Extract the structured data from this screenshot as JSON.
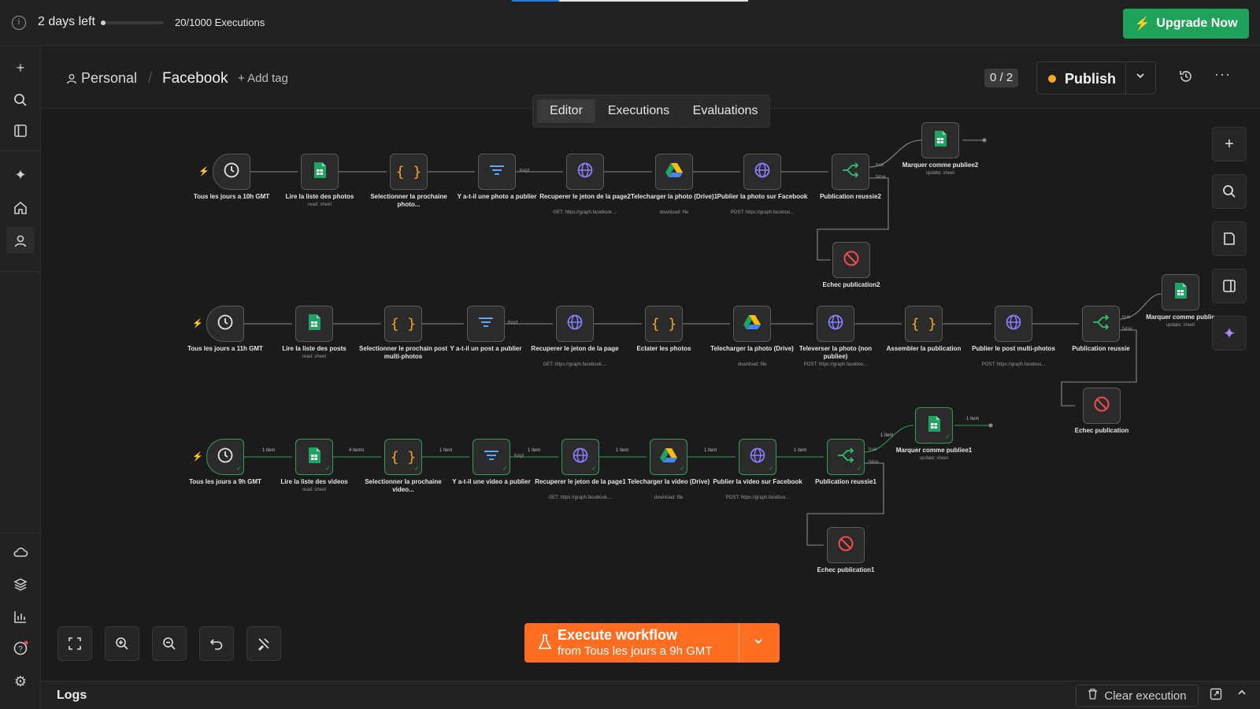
{
  "topbar": {
    "days_left": "2 days left",
    "executions": "20/1000 Executions",
    "upgrade_label": "Upgrade Now",
    "colors": {
      "upgrade": "#1fa35a"
    }
  },
  "header": {
    "project": "Personal",
    "workflow_name": "Facebook",
    "add_tag": "+ Add tag",
    "version_counter": "0 / 2",
    "publish_label": "Publish"
  },
  "tabs": [
    "Editor",
    "Executions",
    "Evaluations"
  ],
  "nodes": [
    {
      "id": "r1n1",
      "label": "Tous les jours a 10h GMT",
      "sub": "",
      "icon": "clock"
    },
    {
      "id": "r1n2",
      "label": "Lire la liste des photos",
      "sub": "read: sheet",
      "icon": "sheets"
    },
    {
      "id": "r1n3",
      "label": "Selectionner la prochaine photo...",
      "sub": "",
      "icon": "code"
    },
    {
      "id": "r1n4",
      "label": "Y a-t-il une photo a publier",
      "sub": "",
      "icon": "filter"
    },
    {
      "id": "r1n5",
      "label": "Recuperer le jeton de la page2",
      "sub": "GET: https://graph.facebook....",
      "icon": "globe"
    },
    {
      "id": "r1n6",
      "label": "Telecharger la photo (Drive)1",
      "sub": "download: file",
      "icon": "drive"
    },
    {
      "id": "r1n7",
      "label": "Publier la photo sur Facebook",
      "sub": "POST: https://graph.faceboo...",
      "icon": "globe"
    },
    {
      "id": "r1n8",
      "label": "Publication reussie2",
      "sub": "",
      "icon": "switch"
    },
    {
      "id": "r1n9",
      "label": "Marquer comme publiee2",
      "sub": "update: sheet",
      "icon": "sheets"
    },
    {
      "id": "r1n10",
      "label": "Echec publication2",
      "sub": "",
      "icon": "stop"
    },
    {
      "id": "r2n1",
      "label": "Tous les jours a 11h GMT",
      "sub": "",
      "icon": "clock"
    },
    {
      "id": "r2n2",
      "label": "Lire la liste des posts",
      "sub": "read: sheet",
      "icon": "sheets"
    },
    {
      "id": "r2n3",
      "label": "Selectionner le prochain post multi-photos",
      "sub": "",
      "icon": "code"
    },
    {
      "id": "r2n4",
      "label": "Y a-t-il un post a publier",
      "sub": "",
      "icon": "filter"
    },
    {
      "id": "r2n5",
      "label": "Recuperer le jeton de la page",
      "sub": "GET: https://graph.facebook....",
      "icon": "globe"
    },
    {
      "id": "r2n6",
      "label": "Eclater les photos",
      "sub": "",
      "icon": "code"
    },
    {
      "id": "r2n7",
      "label": "Telecharger la photo (Drive)",
      "sub": "download: file",
      "icon": "drive"
    },
    {
      "id": "r2n8",
      "label": "Televerser la photo (non publiee)",
      "sub": "POST: https://graph.faceboo...",
      "icon": "globe"
    },
    {
      "id": "r2n9",
      "label": "Assembler la publication",
      "sub": "",
      "icon": "code"
    },
    {
      "id": "r2n10",
      "label": "Publier le post multi-photos",
      "sub": "POST: https://graph.faceboo...",
      "icon": "globe"
    },
    {
      "id": "r2n11",
      "label": "Publication reussie",
      "sub": "",
      "icon": "switch"
    },
    {
      "id": "r2n12",
      "label": "Marquer comme publie",
      "sub": "update: sheet",
      "icon": "sheets"
    },
    {
      "id": "r2n13",
      "label": "Echec publication",
      "sub": "",
      "icon": "stop"
    },
    {
      "id": "r3n1",
      "label": "Tous les jours a 9h GMT",
      "sub": "",
      "icon": "clock"
    },
    {
      "id": "r3n2",
      "label": "Lire la liste des videos",
      "sub": "read: sheet",
      "icon": "sheets"
    },
    {
      "id": "r3n3",
      "label": "Selectionner la prochaine video...",
      "sub": "",
      "icon": "code"
    },
    {
      "id": "r3n4",
      "label": "Y a-t-il une video a publier",
      "sub": "",
      "icon": "filter"
    },
    {
      "id": "r3n5",
      "label": "Recuperer le jeton de la page1",
      "sub": "GET: https://graph.facebook....",
      "icon": "globe"
    },
    {
      "id": "r3n6",
      "label": "Telecharger la video (Drive)",
      "sub": "download: file",
      "icon": "drive"
    },
    {
      "id": "r3n7",
      "label": "Publier la video sur Facebook",
      "sub": "POST: https://graph.faceboo...",
      "icon": "globe"
    },
    {
      "id": "r3n8",
      "label": "Publication reussie1",
      "sub": "",
      "icon": "switch"
    },
    {
      "id": "r3n9",
      "label": "Marquer comme publiee1",
      "sub": "update: sheet",
      "icon": "sheets"
    },
    {
      "id": "r3n10",
      "label": "Echec publication1",
      "sub": "",
      "icon": "stop"
    }
  ],
  "edge_labels": {
    "kept": "Kept",
    "true": "true",
    "false": "false",
    "one_item": "1 item",
    "four_items": "4 items"
  },
  "execute": {
    "title": "Execute workflow",
    "subtitle": "from Tous les jours a 9h GMT",
    "color": "#ff6d21"
  },
  "logs": {
    "label": "Logs",
    "clear": "Clear execution"
  }
}
